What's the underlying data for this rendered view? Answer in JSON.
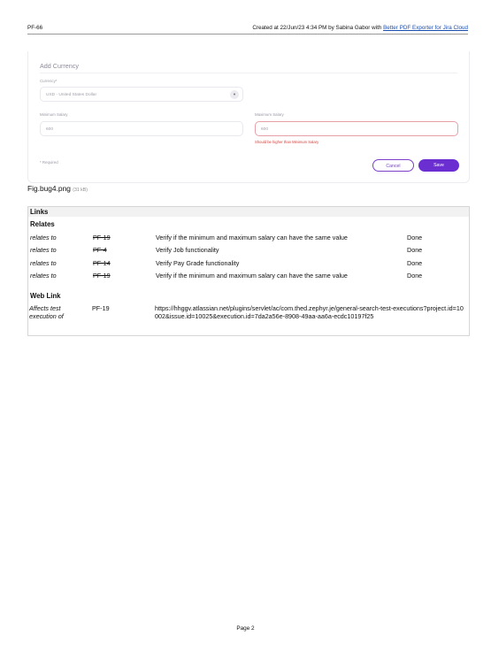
{
  "header": {
    "issue_key": "PF-66",
    "created_text": "Created at 22/Jun/23 4:34 PM by Sabina Gabor with ",
    "exporter_link": "Better PDF Exporter for Jira Cloud"
  },
  "screenshot": {
    "title": "Add Currency",
    "currency_label": "Currency*",
    "currency_value": "USD - United States Dollar",
    "min_label": "Minimum Salary",
    "min_value": "600",
    "max_label": "Maximum Salary",
    "max_value": "600",
    "error_message": "Should be higher than Minimum Salary",
    "required_note": "* Required",
    "cancel_label": "Cancel",
    "save_label": "Save"
  },
  "attachment": {
    "name": "Fig.bug4.png",
    "size": "(31 kB)"
  },
  "links": {
    "section_title": "Links",
    "relates_title": "Relates",
    "relates": [
      {
        "type": "relates to",
        "key": "PF-19",
        "summary": "Verify if the minimum and maximum salary can have the same value",
        "status": "Done"
      },
      {
        "type": "relates to",
        "key": "PF-4",
        "summary": "Verify Job functionality",
        "status": "Done"
      },
      {
        "type": "relates to",
        "key": "PF-14",
        "summary": "Verify Pay Grade functionality",
        "status": "Done"
      },
      {
        "type": "relates to",
        "key": "PF-19",
        "summary": "Verify if the minimum and maximum salary can have the same value",
        "status": "Done"
      }
    ],
    "weblink_title": "Web Link",
    "weblink": {
      "type": "Affects test execution of",
      "key": "PF-19",
      "url": "https://hhggv.atlassian.net/plugins/servlet/ac/com.thed.zephyr.je/general-search-test-executions?project.id=10002&issue.id=10025&execution.id=7da2a56e-8908-49aa-aa6a-ecdc10197f25"
    }
  },
  "footer": {
    "page_label": "Page 2"
  }
}
